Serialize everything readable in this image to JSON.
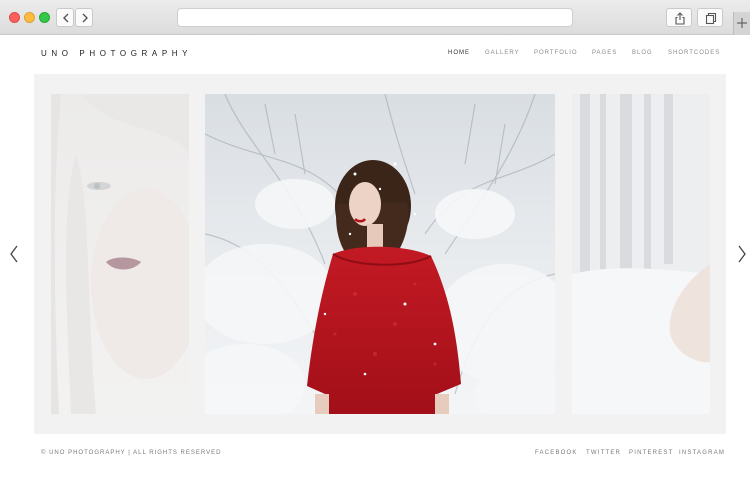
{
  "site": {
    "logo": "UNO PHOTOGRAPHY",
    "nav": [
      {
        "label": "HOME",
        "active": true
      },
      {
        "label": "GALLERY",
        "active": false
      },
      {
        "label": "PORTFOLIO",
        "active": false
      },
      {
        "label": "PAGES",
        "active": false
      },
      {
        "label": "BLOG",
        "active": false
      },
      {
        "label": "SHORTCODES",
        "active": false
      }
    ]
  },
  "slider": {
    "slides": [
      {
        "subject": "portrait of blonde woman",
        "state": "faded"
      },
      {
        "subject": "woman in red poncho in snowy forest",
        "state": "active"
      },
      {
        "subject": "snowy forest path",
        "state": "faded"
      }
    ]
  },
  "footer": {
    "copyright": "© UNO PHOTOGRAPHY | ALL RIGHTS RESERVED",
    "social": [
      "FACEBOOK",
      "TWITTER",
      "PINTEREST",
      "INSTAGRAM"
    ]
  },
  "colors": {
    "accent_red": "#b3131d",
    "text_dark": "#222222",
    "text_muted": "#8a8a8a",
    "stage_bg": "#f2f2f2"
  }
}
